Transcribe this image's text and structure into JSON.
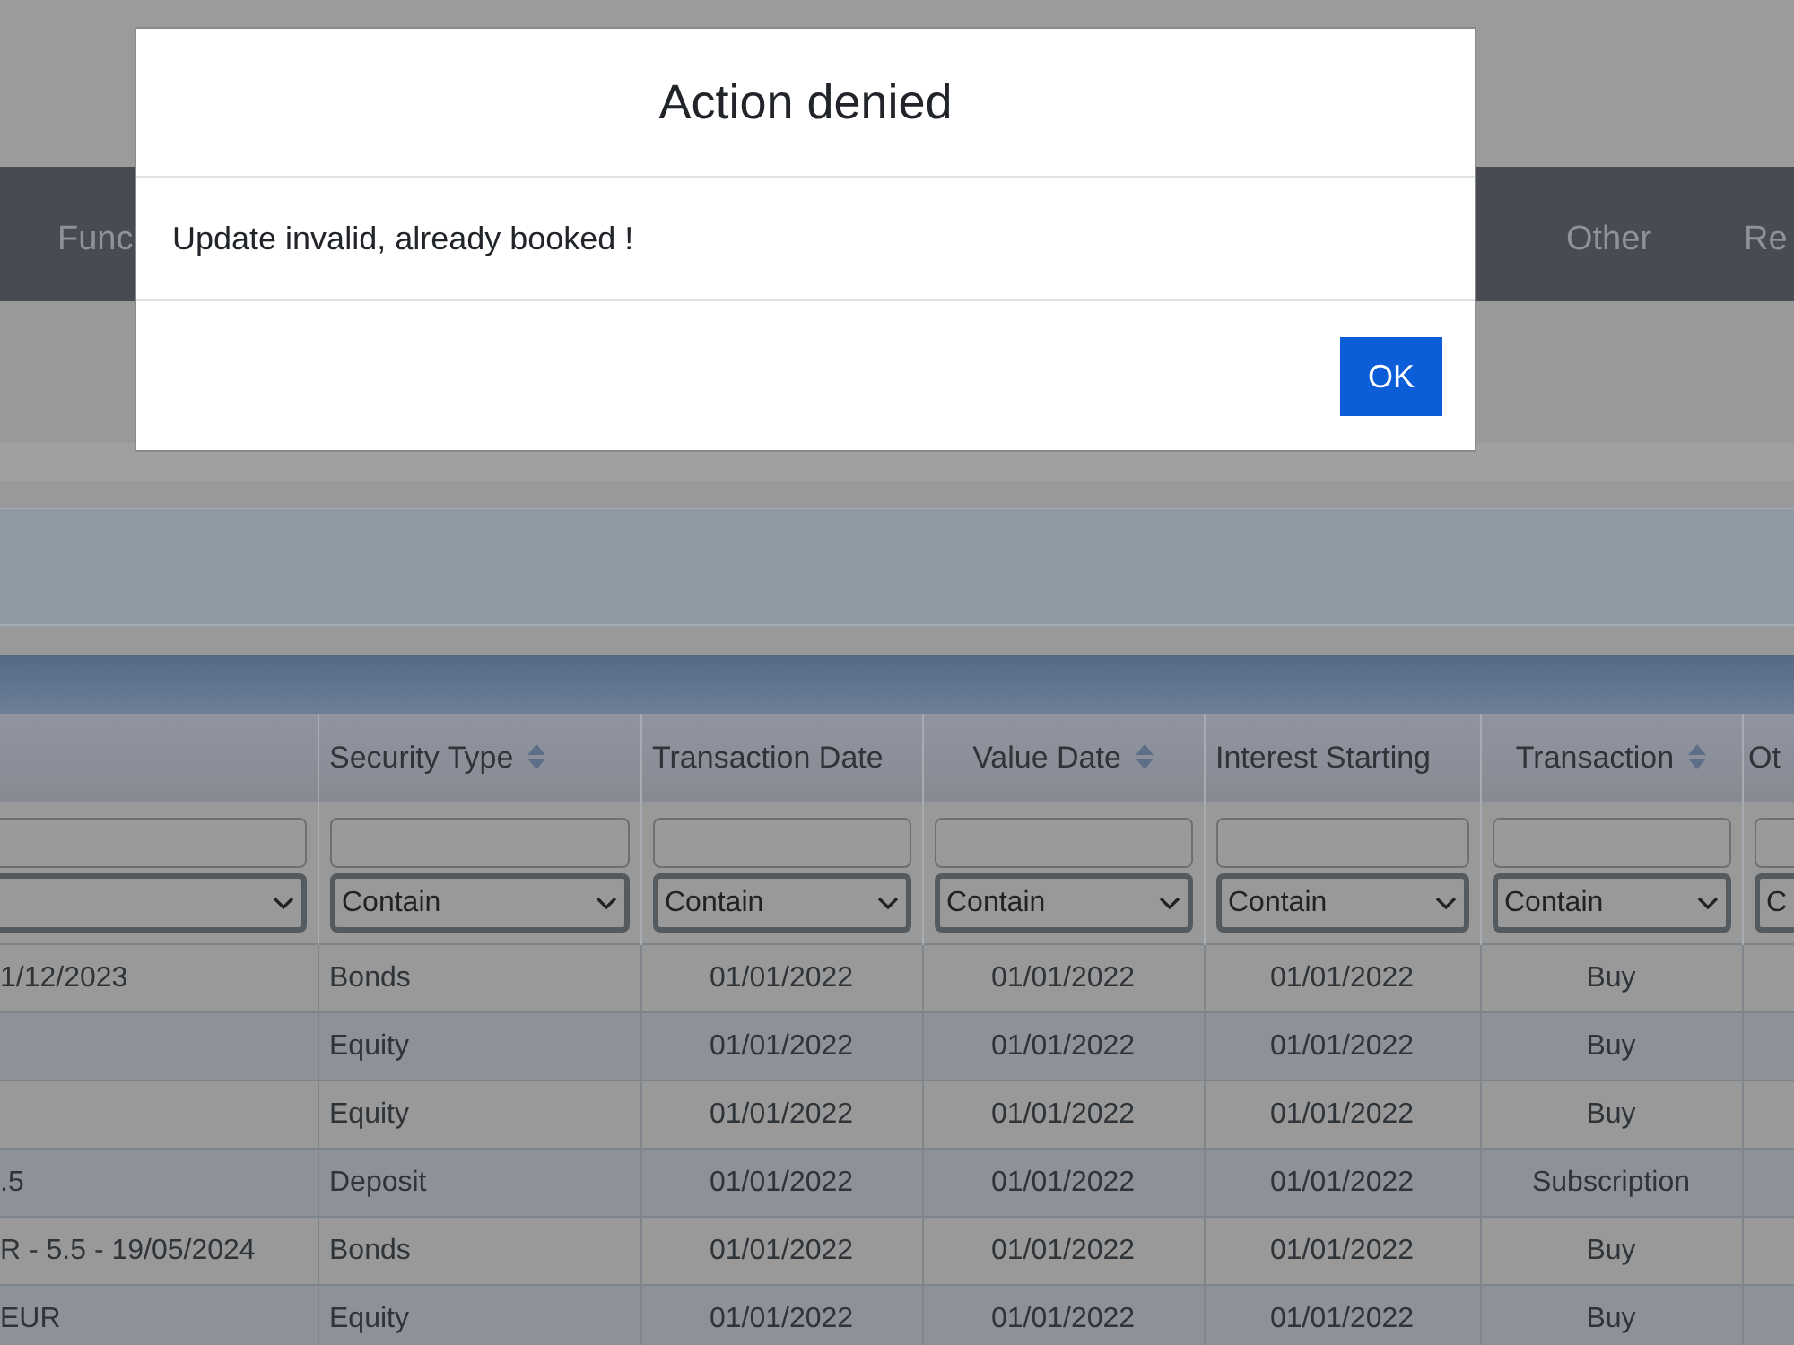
{
  "nav": {
    "items": [
      "Func",
      "Other",
      "Re"
    ]
  },
  "table": {
    "columns": [
      {
        "sortable": false
      },
      {
        "label": "Security Type",
        "sortable": true
      },
      {
        "label": "Transaction Date",
        "sortable": false
      },
      {
        "label": "Value Date",
        "sortable": true
      },
      {
        "label": "Interest Starting",
        "sortable": false
      },
      {
        "label": "Transaction",
        "sortable": true
      },
      {
        "label": "Ot"
      }
    ],
    "filters": [
      {
        "match": "Contain"
      },
      {
        "match": "Contain"
      },
      {
        "match": "Contain"
      },
      {
        "match": "Contain"
      },
      {
        "match": "Contain"
      },
      {
        "match": "C"
      }
    ],
    "rows": [
      {
        "cells": [
          "1/12/2023",
          "Bonds",
          "01/01/2022",
          "01/01/2022",
          "01/01/2022",
          "Buy"
        ]
      },
      {
        "cells": [
          "",
          "Equity",
          "01/01/2022",
          "01/01/2022",
          "01/01/2022",
          "Buy"
        ]
      },
      {
        "cells": [
          "",
          "Equity",
          "01/01/2022",
          "01/01/2022",
          "01/01/2022",
          "Buy"
        ]
      },
      {
        "cells": [
          ".5",
          "Deposit",
          "01/01/2022",
          "01/01/2022",
          "01/01/2022",
          "Subscription"
        ]
      },
      {
        "cells": [
          "R - 5.5 - 19/05/2024",
          "Bonds",
          "01/01/2022",
          "01/01/2022",
          "01/01/2022",
          "Buy"
        ]
      },
      {
        "cells": [
          "EUR",
          "Equity",
          "01/01/2022",
          "01/01/2022",
          "01/01/2022",
          "Buy"
        ]
      }
    ]
  },
  "dialog": {
    "title": "Action denied",
    "message": "Update invalid, already booked !",
    "button": "OK"
  }
}
